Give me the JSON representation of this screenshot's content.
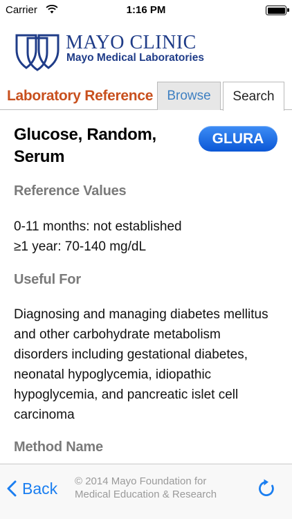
{
  "status_bar": {
    "carrier": "Carrier",
    "time": "1:16 PM"
  },
  "header": {
    "logo_title": "MAYO CLINIC",
    "logo_subtitle": "Mayo Medical Laboratories"
  },
  "nav": {
    "section_title": "Laboratory Reference",
    "tabs": [
      {
        "label": "Browse"
      },
      {
        "label": "Search"
      }
    ],
    "selected_tab": "Search"
  },
  "test": {
    "name": "Glucose, Random, Serum",
    "code": "GLURA",
    "sections": [
      {
        "heading": "Reference Values",
        "lines": [
          "0-11 months: not established",
          "≥1 year: 70-140 mg/dL"
        ]
      },
      {
        "heading": "Useful For",
        "text": "Diagnosing and managing diabetes mellitus and other carbohydrate metabolism disorders including gestational diabetes, neonatal hypoglycemia, idiopathic hypoglycemia, and pancreatic islet cell carcinoma"
      },
      {
        "heading": "Method Name"
      }
    ]
  },
  "toolbar": {
    "back_label": "Back",
    "copyright_line1": "© 2014 Mayo Foundation for",
    "copyright_line2": "Medical Education & Research"
  },
  "colors": {
    "brand_blue": "#1f3c88",
    "accent_orange": "#c8501e",
    "link_blue": "#1a7ef0",
    "badge_blue": "#0b57d6"
  },
  "icons": {
    "wifi": "wifi-icon",
    "battery": "battery-icon",
    "back": "chevron-left-icon",
    "refresh": "refresh-icon"
  }
}
